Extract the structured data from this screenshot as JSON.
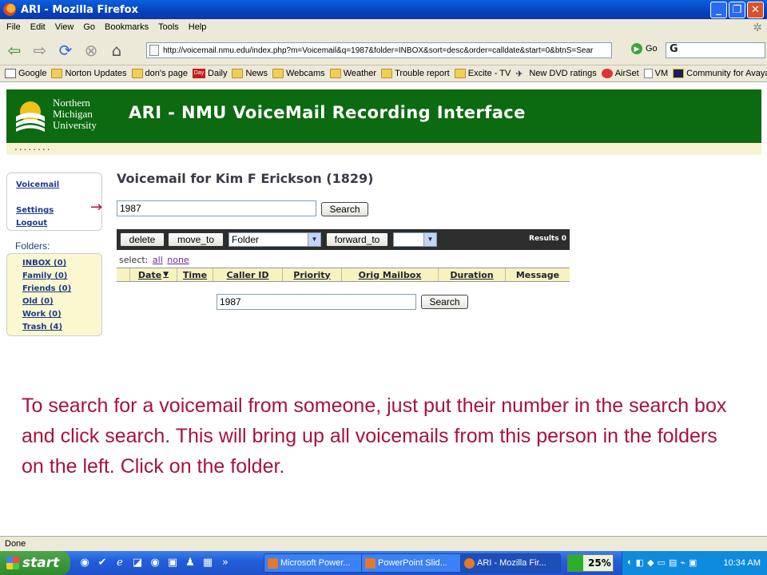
{
  "window": {
    "title": "ARI - Mozilla Firefox",
    "minimize": "_",
    "maximize": "❐",
    "close": "✕"
  },
  "menu": [
    "File",
    "Edit",
    "View",
    "Go",
    "Bookmarks",
    "Tools",
    "Help"
  ],
  "nav": {
    "url": "http://voicemail.nmu.edu/index.php?m=Voicemail&q=1987&folder=INBOX&sort=desc&order=calldate&start=0&btnS=Sear",
    "go_label": "Go",
    "google_glyph": "G"
  },
  "bookmarks": [
    "Google",
    "Norton Updates",
    "don's page",
    "Daily",
    "News",
    "Webcams",
    "Weather",
    "Trouble report",
    "Excite - TV",
    "New DVD ratings",
    "AirSet",
    "VM",
    "Community for Avaya..."
  ],
  "bookmark_day_badge": "Day",
  "banner": {
    "logo_line1": "Northern",
    "logo_line2": "Michigan",
    "logo_line3": "University",
    "title": "ARI - NMU VoiceMail Recording Interface",
    "dots": "........"
  },
  "sidebar": {
    "voicemail": "Voicemail",
    "settings": "Settings",
    "logout": "Logout",
    "folders_label": "Folders:",
    "folders": [
      "INBOX (0)",
      "Family (0)",
      "Friends (0)",
      "Old (0)",
      "Work (0)",
      "Trash (4)"
    ]
  },
  "main": {
    "title": "Voicemail for Kim F Erickson (1829)",
    "search_value": "1987",
    "search_button": "Search",
    "toolbar": {
      "delete": "delete",
      "move_to": "move_to",
      "folder_select": "Folder",
      "forward_to": "forward_to",
      "forward_select": "",
      "results": "Results 0"
    },
    "select_label": "select:",
    "select_all": "all",
    "select_none": "none",
    "columns": [
      "Date",
      "Time",
      "Caller ID",
      "Priority",
      "Orig Mailbox",
      "Duration",
      "Message"
    ],
    "bottom_search_value": "1987",
    "bottom_search_button": "Search"
  },
  "instruction": "To search for a voicemail from someone, just put their number in the search box and click search.   This will bring up all voicemails from this person in the folders on the left.   Click on the folder.",
  "status": "Done",
  "taskbar": {
    "start": "start",
    "overflow": "»",
    "tasks": [
      "Microsoft Power...",
      "PowerPoint Slid...",
      "ARI - Mozilla Fir..."
    ],
    "meter": "25%",
    "meter_level": 0.25,
    "clock": "10:34 AM"
  },
  "colors": {
    "banner": "#0c6a10",
    "instruction": "#a8123e",
    "link": "#1d3a8a",
    "folder_bg": "#fbf8cf"
  }
}
